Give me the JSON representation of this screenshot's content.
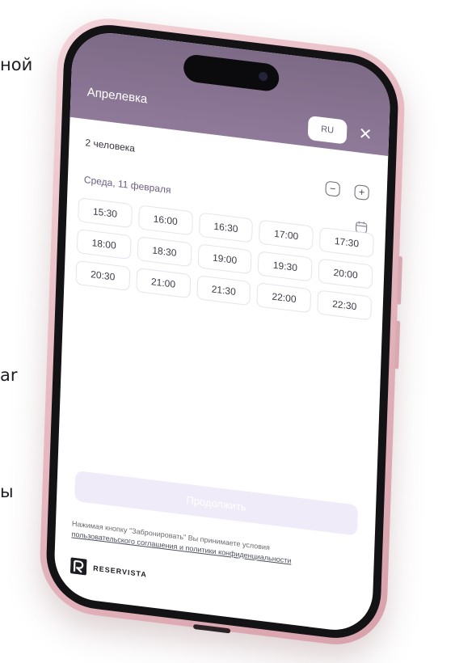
{
  "background_fragments": {
    "line1": "ной",
    "line2": "ar",
    "line3": "ы"
  },
  "app": {
    "venue_name": "Апрелевка",
    "language": "RU",
    "close_glyph": "✕"
  },
  "booking": {
    "guests_label": "2 человека",
    "minus_glyph": "−",
    "plus_glyph": "+",
    "date_label": "Среда, 11 февраля"
  },
  "time_slots": [
    "15:30",
    "16:00",
    "16:30",
    "17:00",
    "17:30",
    "18:00",
    "18:30",
    "19:00",
    "19:30",
    "20:00",
    "20:30",
    "21:00",
    "21:30",
    "22:00",
    "22:30"
  ],
  "footer": {
    "continue_label": "Продолжить",
    "terms_text": "Нажимая кнопку \"Забронировать\" Вы принимаете условия",
    "terms_link": "пользовательского соглашения и политики конфиденциальности",
    "brand_name": "RESERVISTA"
  },
  "colors": {
    "header_purple": "#8f7b99",
    "date_purple": "#6c5f84",
    "continue_disabled": "#f0ebf8",
    "phone_pink": "#e7b9c1"
  },
  "icons": {
    "calendar": "calendar-icon",
    "close": "close-icon",
    "minus": "minus-icon",
    "plus": "plus-icon",
    "logo": "reservista-logo-icon"
  }
}
